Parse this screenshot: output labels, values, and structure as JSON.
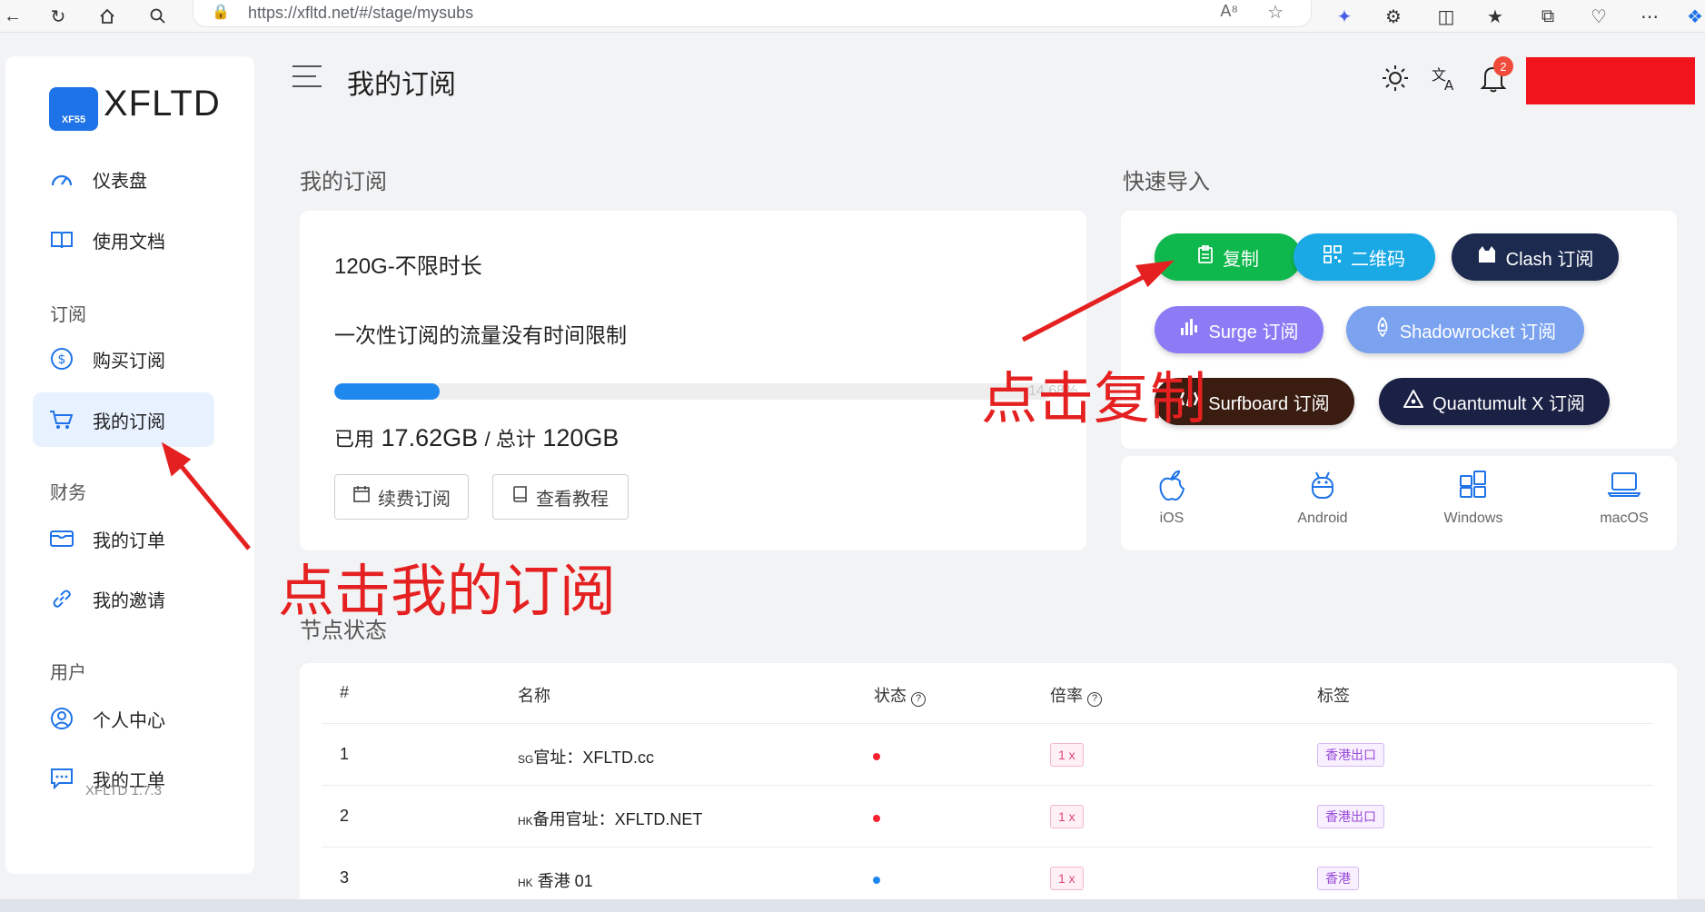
{
  "browser": {
    "url": "https://xfltd.net/#/stage/mysubs"
  },
  "sidebar": {
    "logo_badge": "XF55",
    "logo_text": "XFLTD",
    "items": [
      {
        "label": "仪表盘"
      },
      {
        "label": "使用文档"
      },
      {
        "label": "购买订阅"
      },
      {
        "label": "我的订阅"
      },
      {
        "label": "我的订单"
      },
      {
        "label": "我的邀请"
      },
      {
        "label": "个人中心"
      },
      {
        "label": "我的工单"
      }
    ],
    "groups": {
      "subscribe": "订阅",
      "finance": "财务",
      "user": "用户"
    },
    "version": "XFLTD 1.7.3"
  },
  "header": {
    "title": "我的订阅",
    "notification_count": "2"
  },
  "subscription": {
    "section_title": "我的订阅",
    "plan_name": "120G-不限时长",
    "plan_desc": "一次性订阅的流量没有时间限制",
    "progress_fraction": 0.1468,
    "progress_text": "14.68%",
    "used_label": "已用",
    "used_value": "17.62GB",
    "total_label": "/ 总计",
    "total_value": "120GB",
    "renew_button": "续费订阅",
    "tutorial_button": "查看教程"
  },
  "quick_import": {
    "section_title": "快速导入",
    "buttons": [
      {
        "label": "复制",
        "color": "#0fb84c"
      },
      {
        "label": "二维码",
        "color": "#1ba9e6"
      },
      {
        "label": "Clash 订阅",
        "color": "#1b2a4e"
      },
      {
        "label": "Surge 订阅",
        "color": "#8b7cf6"
      },
      {
        "label": "Shadowrocket 订阅",
        "color": "#7aa2ef"
      },
      {
        "label": "Surfboard 订阅",
        "color": "#3a1d10"
      },
      {
        "label": "Quantumult X 订阅",
        "color": "#1b2145"
      }
    ],
    "platforms": [
      {
        "label": "iOS",
        "icon": "apple-icon"
      },
      {
        "label": "Android",
        "icon": "android-icon"
      },
      {
        "label": "Windows",
        "icon": "windows-icon"
      },
      {
        "label": "macOS",
        "icon": "laptop-icon"
      }
    ]
  },
  "nodes": {
    "section_title": "节点状态",
    "columns": [
      "#",
      "名称",
      "状态",
      "倍率",
      "标签"
    ],
    "rows": [
      {
        "index": "1",
        "flag": "SG",
        "name": "官址：XFLTD.cc",
        "status_color": "#f5222d",
        "rate": "1 x",
        "tag": "香港出口"
      },
      {
        "index": "2",
        "flag": "HK",
        "name": "备用官址：XFLTD.NET",
        "status_color": "#f5222d",
        "rate": "1 x",
        "tag": "香港出口"
      },
      {
        "index": "3",
        "flag": "HK",
        "name": " 香港 01",
        "status_color": "#1e88ef",
        "rate": "1 x",
        "tag": "香港"
      }
    ]
  },
  "annotations": {
    "click_copy": "点击复制",
    "click_mysubs": "点击我的订阅",
    "color": "#e52020"
  }
}
